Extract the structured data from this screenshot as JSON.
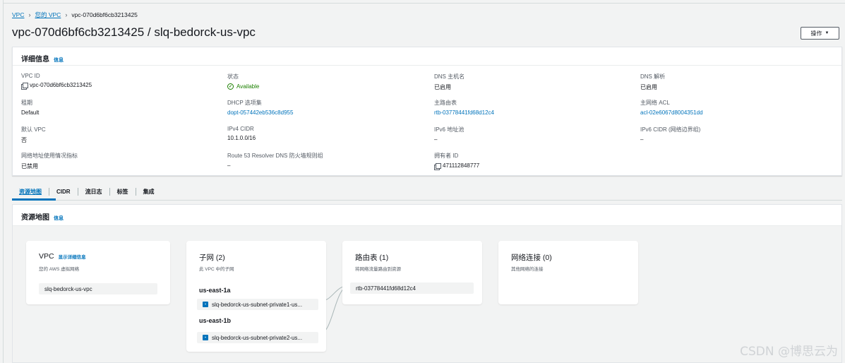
{
  "breadcrumb": {
    "root": "VPC",
    "your_vpcs": "您的 VPC",
    "current": "vpc-070d6bf6cb3213425"
  },
  "page": {
    "title": "vpc-070d6bf6cb3213425 / slq-bedorck-us-vpc",
    "actions_label": "操作"
  },
  "details": {
    "header": "详细信息",
    "info_link": "信息",
    "columns": [
      [
        {
          "label": "VPC ID",
          "value": "vpc-070d6bf6cb3213425",
          "icon": "copy-icon"
        },
        {
          "label": "租期",
          "value": "Default"
        },
        {
          "label": "默认 VPC",
          "value": "否"
        },
        {
          "label": "网络地址使用情况指标",
          "value": "已禁用"
        }
      ],
      [
        {
          "label": "状态",
          "value": "Available",
          "icon": "check-circle-icon"
        },
        {
          "label": "DHCP 选项集",
          "value": "dopt-057442eb536c8d955",
          "link": true
        },
        {
          "label": "IPv4 CIDR",
          "value": "10.1.0.0/16"
        },
        {
          "label": "Route 53 Resolver DNS 防火墙规则组",
          "value": "–"
        }
      ],
      [
        {
          "label": "DNS 主机名",
          "value": "已启用"
        },
        {
          "label": "主路由表",
          "value": "rtb-03778441fd68d12c4",
          "link": true
        },
        {
          "label": "IPv6 地址池",
          "value": "–"
        },
        {
          "label": "拥有者 ID",
          "value": "471112848777",
          "icon": "copy-icon"
        }
      ],
      [
        {
          "label": "DNS 解析",
          "value": "已启用"
        },
        {
          "label": "主网络 ACL",
          "value": "acl-02e6067d8004351dd",
          "link": true
        },
        {
          "label": "IPv6 CIDR (网络边界组)",
          "value": "–"
        }
      ]
    ]
  },
  "tabs": [
    "资源地图",
    "CIDR",
    "流日志",
    "标签",
    "集成"
  ],
  "resource_map": {
    "header": "资源地图",
    "info_link": "信息",
    "vpc_card": {
      "title": "VPC",
      "detail_link": "显示详细信息",
      "subtitle": "您的 AWS 虚拟网络",
      "resource": "slq-bedorck-us-vpc"
    },
    "subnet_card": {
      "title": "子网 (2)",
      "subtitle": "此 VPC 中的子网",
      "zones": [
        {
          "name": "us-east-1a",
          "subnet": "slq-bedorck-us-subnet-private1-us..."
        },
        {
          "name": "us-east-1b",
          "subnet": "slq-bedorck-us-subnet-private2-us..."
        }
      ]
    },
    "route_card": {
      "title": "路由表 (1)",
      "subtitle": "将网络流量路由到资源",
      "resource": "rtb-03778441fd68d12c4"
    },
    "network_card": {
      "title": "网络连接 (0)",
      "subtitle": "其他网络的连接"
    }
  },
  "watermark": "CSDN @博思云为",
  "colors": {
    "link": "#0073bb",
    "status_ok": "#1d8102",
    "background": "#f2f3f3"
  }
}
